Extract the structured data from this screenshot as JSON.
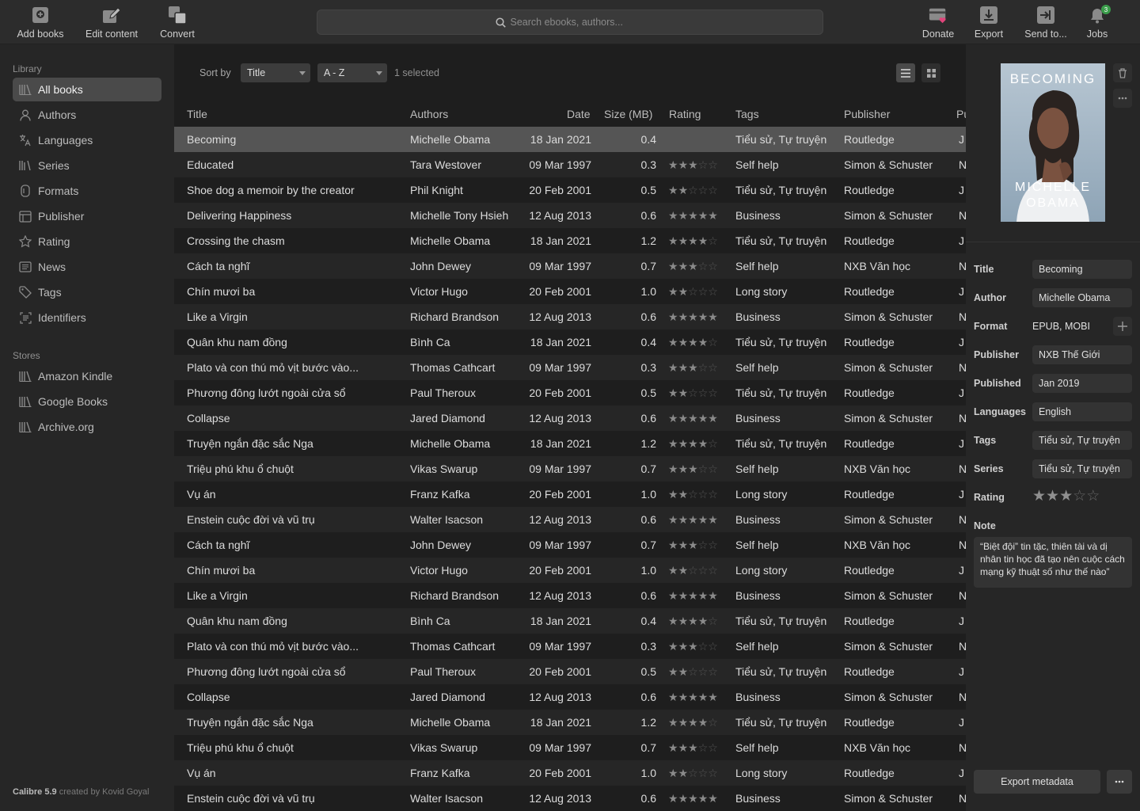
{
  "toolbar": {
    "add_books": "Add books",
    "edit_content": "Edit content",
    "convert": "Convert",
    "search_placeholder": "Search ebooks, authors...",
    "donate": "Donate",
    "export": "Export",
    "send_to": "Send to...",
    "jobs": "Jobs",
    "jobs_badge": "3"
  },
  "sidebar": {
    "library_title": "Library",
    "library_items": [
      {
        "label": "All books",
        "icon": "books-icon"
      },
      {
        "label": "Authors",
        "icon": "person-icon"
      },
      {
        "label": "Languages",
        "icon": "translate-icon"
      },
      {
        "label": "Series",
        "icon": "series-icon"
      },
      {
        "label": "Formats",
        "icon": "file-icon"
      },
      {
        "label": "Publisher",
        "icon": "building-icon"
      },
      {
        "label": "Rating",
        "icon": "star-icon"
      },
      {
        "label": "News",
        "icon": "news-icon"
      },
      {
        "label": "Tags",
        "icon": "tag-icon"
      },
      {
        "label": "Identifiers",
        "icon": "identifier-icon"
      }
    ],
    "stores_title": "Stores",
    "store_items": [
      {
        "label": "Amazon Kindle",
        "icon": "books-icon"
      },
      {
        "label": "Google Books",
        "icon": "books-icon"
      },
      {
        "label": "Archive.org",
        "icon": "books-icon"
      }
    ],
    "credit_app": "Calibre 5.9",
    "credit_by": "created by Kovid Goyal"
  },
  "sortbar": {
    "label": "Sort by",
    "field": "Title",
    "order": "A - Z",
    "selected": "1 selected"
  },
  "table": {
    "columns": [
      "Title",
      "Authors",
      "Date",
      "Size (MB)",
      "Rating",
      "Tags",
      "Publisher",
      "Pu"
    ],
    "rows": [
      {
        "title": "Becoming",
        "author": "Michelle Obama",
        "date": "18 Jan 2021",
        "size": "0.4",
        "rating": 0,
        "tags": "Tiểu sử, Tự truyện",
        "publisher": "Routledge",
        "pu": "J"
      },
      {
        "title": "Educated",
        "author": "Tara Westover",
        "date": "09 Mar 1997",
        "size": "0.3",
        "rating": 3,
        "tags": "Self help",
        "publisher": "Simon & Schuster",
        "pu": "N"
      },
      {
        "title": "Shoe dog a memoir by the creator",
        "author": "Phil Knight",
        "date": "20 Feb 2001",
        "size": "0.5",
        "rating": 2,
        "tags": "Tiểu sử, Tự truyện",
        "publisher": "Routledge",
        "pu": "J"
      },
      {
        "title": "Delivering Happiness",
        "author": "Michelle Tony Hsieh",
        "date": "12 Aug 2013",
        "size": "0.6",
        "rating": 5,
        "tags": "Business",
        "publisher": "Simon & Schuster",
        "pu": "N"
      },
      {
        "title": "Crossing the chasm",
        "author": "Michelle Obama",
        "date": "18 Jan 2021",
        "size": "1.2",
        "rating": 4,
        "tags": "Tiểu sử, Tự truyện",
        "publisher": "Routledge",
        "pu": "J"
      },
      {
        "title": "Cách ta nghĩ",
        "author": "John Dewey",
        "date": "09 Mar 1997",
        "size": "0.7",
        "rating": 3,
        "tags": "Self help",
        "publisher": "NXB Văn học",
        "pu": "N"
      },
      {
        "title": "Chín mươi ba",
        "author": "Victor Hugo",
        "date": "20 Feb 2001",
        "size": "1.0",
        "rating": 2,
        "tags": "Long story",
        "publisher": "Routledge",
        "pu": "J"
      },
      {
        "title": "Like a Virgin",
        "author": "Richard Brandson",
        "date": "12 Aug 2013",
        "size": "0.6",
        "rating": 5,
        "tags": "Business",
        "publisher": "Simon & Schuster",
        "pu": "N"
      },
      {
        "title": "Quân khu nam đồng",
        "author": "Bình Ca",
        "date": "18 Jan 2021",
        "size": "0.4",
        "rating": 4,
        "tags": "Tiểu sử, Tự truyện",
        "publisher": "Routledge",
        "pu": "J"
      },
      {
        "title": "Plato và con thú mỏ vịt bước vào...",
        "author": "Thomas Cathcart",
        "date": "09 Mar 1997",
        "size": "0.3",
        "rating": 3,
        "tags": "Self help",
        "publisher": "Simon & Schuster",
        "pu": "N"
      },
      {
        "title": "Phương đông lướt ngoài cửa sổ",
        "author": "Paul Theroux",
        "date": "20 Feb 2001",
        "size": "0.5",
        "rating": 2,
        "tags": "Tiểu sử, Tự truyện",
        "publisher": "Routledge",
        "pu": "J"
      },
      {
        "title": "Collapse",
        "author": "Jared Diamond",
        "date": "12 Aug 2013",
        "size": "0.6",
        "rating": 5,
        "tags": "Business",
        "publisher": "Simon & Schuster",
        "pu": "N"
      },
      {
        "title": "Truyện ngắn đặc sắc Nga",
        "author": "Michelle Obama",
        "date": "18 Jan 2021",
        "size": "1.2",
        "rating": 4,
        "tags": "Tiểu sử, Tự truyện",
        "publisher": "Routledge",
        "pu": "J"
      },
      {
        "title": "Triệu phú khu ổ chuột",
        "author": "Vikas Swarup",
        "date": "09 Mar 1997",
        "size": "0.7",
        "rating": 3,
        "tags": "Self help",
        "publisher": "NXB Văn học",
        "pu": "N"
      },
      {
        "title": "Vụ án",
        "author": "Franz Kafka",
        "date": "20 Feb 2001",
        "size": "1.0",
        "rating": 2,
        "tags": "Long story",
        "publisher": "Routledge",
        "pu": "J"
      },
      {
        "title": "Enstein cuộc đời và vũ trụ",
        "author": "Walter Isacson",
        "date": "12 Aug 2013",
        "size": "0.6",
        "rating": 5,
        "tags": "Business",
        "publisher": "Simon & Schuster",
        "pu": "N"
      },
      {
        "title": "Cách ta nghĩ",
        "author": "John Dewey",
        "date": "09 Mar 1997",
        "size": "0.7",
        "rating": 3,
        "tags": "Self help",
        "publisher": "NXB Văn học",
        "pu": "N"
      },
      {
        "title": "Chín mươi ba",
        "author": "Victor Hugo",
        "date": "20 Feb 2001",
        "size": "1.0",
        "rating": 2,
        "tags": "Long story",
        "publisher": "Routledge",
        "pu": "J"
      },
      {
        "title": "Like a Virgin",
        "author": "Richard Brandson",
        "date": "12 Aug 2013",
        "size": "0.6",
        "rating": 5,
        "tags": "Business",
        "publisher": "Simon & Schuster",
        "pu": "N"
      },
      {
        "title": "Quân khu nam đồng",
        "author": "Bình Ca",
        "date": "18 Jan 2021",
        "size": "0.4",
        "rating": 4,
        "tags": "Tiểu sử, Tự truyện",
        "publisher": "Routledge",
        "pu": "J"
      },
      {
        "title": "Plato và con thú mỏ vịt bước vào...",
        "author": "Thomas Cathcart",
        "date": "09 Mar 1997",
        "size": "0.3",
        "rating": 3,
        "tags": "Self help",
        "publisher": "Simon & Schuster",
        "pu": "N"
      },
      {
        "title": "Phương đông lướt ngoài cửa sổ",
        "author": "Paul Theroux",
        "date": "20 Feb 2001",
        "size": "0.5",
        "rating": 2,
        "tags": "Tiểu sử, Tự truyện",
        "publisher": "Routledge",
        "pu": "J"
      },
      {
        "title": "Collapse",
        "author": "Jared Diamond",
        "date": "12 Aug 2013",
        "size": "0.6",
        "rating": 5,
        "tags": "Business",
        "publisher": "Simon & Schuster",
        "pu": "N"
      },
      {
        "title": "Truyện ngắn đặc sắc Nga",
        "author": "Michelle Obama",
        "date": "18 Jan 2021",
        "size": "1.2",
        "rating": 4,
        "tags": "Tiểu sử, Tự truyện",
        "publisher": "Routledge",
        "pu": "J"
      },
      {
        "title": "Triệu phú khu ổ chuột",
        "author": "Vikas Swarup",
        "date": "09 Mar 1997",
        "size": "0.7",
        "rating": 3,
        "tags": "Self help",
        "publisher": "NXB Văn học",
        "pu": "N"
      },
      {
        "title": "Vụ án",
        "author": "Franz Kafka",
        "date": "20 Feb 2001",
        "size": "1.0",
        "rating": 2,
        "tags": "Long story",
        "publisher": "Routledge",
        "pu": "J"
      },
      {
        "title": "Enstein cuộc đời và vũ trụ",
        "author": "Walter Isacson",
        "date": "12 Aug 2013",
        "size": "0.6",
        "rating": 5,
        "tags": "Business",
        "publisher": "Simon & Schuster",
        "pu": "N"
      }
    ],
    "selected_index": 0
  },
  "detail": {
    "cover_title": "BECOMING",
    "cover_author_line1": "MICHELLE",
    "cover_author_line2": "OBAMA",
    "labels": {
      "title": "Title",
      "author": "Author",
      "format": "Format",
      "publisher": "Publisher",
      "published": "Published",
      "languages": "Languages",
      "tags": "Tags",
      "series": "Series",
      "rating": "Rating",
      "note": "Note"
    },
    "values": {
      "title": "Becoming",
      "author": "Michelle Obama",
      "format": "EPUB, MOBI",
      "publisher": "NXB Thế Giới",
      "published": "Jan 2019",
      "languages": "English",
      "tags": "Tiểu sử, Tự truyện",
      "series": "Tiểu sử, Tự truyện",
      "rating": 3,
      "note": "“Biệt đội” tin tặc, thiên tài và dị nhân tin học đã tạo nên cuộc cách mạng kỹ thuật số như thế nào”"
    },
    "export_label": "Export metadata"
  },
  "colors": {
    "toolbar_bg": "#2c2c2c",
    "sidebar_bg": "#262626",
    "main_bg": "#1e1e1e",
    "selected_row": "#555555",
    "badge": "#3a9d4a",
    "donate_heart": "#e0457b"
  }
}
